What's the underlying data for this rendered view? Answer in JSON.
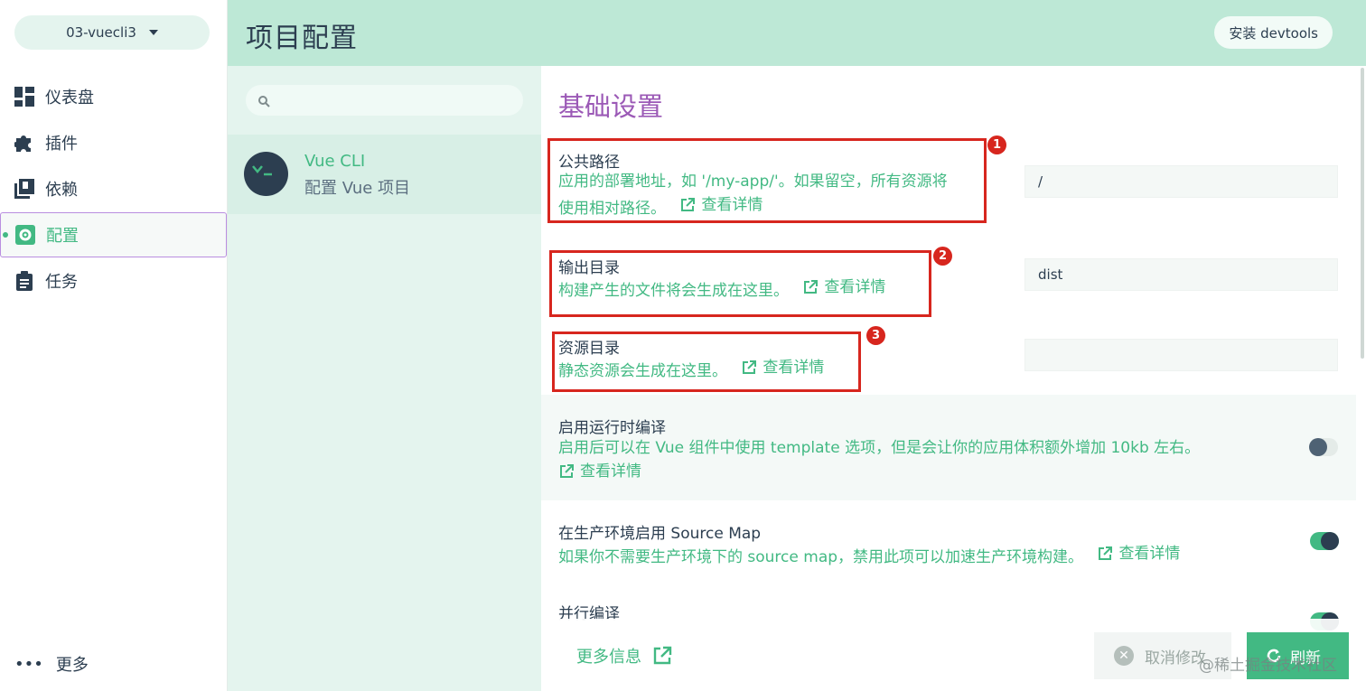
{
  "nav": {
    "project_name": "03-vuecli3",
    "items": [
      {
        "label": "仪表盘",
        "icon": "dashboard-icon"
      },
      {
        "label": "插件",
        "icon": "puzzle-icon"
      },
      {
        "label": "依赖",
        "icon": "library-icon"
      },
      {
        "label": "配置",
        "icon": "gear-icon"
      },
      {
        "label": "任务",
        "icon": "clipboard-icon"
      }
    ],
    "active_item": "配置",
    "more_label": "更多"
  },
  "header": {
    "title": "项目配置",
    "devtools_button": "安装 devtools"
  },
  "sidebar": {
    "search_placeholder": "",
    "configs": [
      {
        "title": "Vue CLI",
        "subtitle": "配置 Vue 项目"
      }
    ]
  },
  "main": {
    "section_title": "基础设置",
    "link_label": "查看详情",
    "prompts": [
      {
        "title": "公共路径",
        "desc_line1": "应用的部署地址，如 '/my-app/'。如果留空，所有资源将",
        "desc_line2": "使用相对路径。",
        "value": "/",
        "badge": "1"
      },
      {
        "title": "输出目录",
        "desc": "构建产生的文件将会生成在这里。",
        "value": "dist",
        "badge": "2"
      },
      {
        "title": "资源目录",
        "desc": "静态资源会生成在这里。",
        "value": "",
        "badge": "3"
      },
      {
        "title": "启用运行时编译",
        "desc": "启用后可以在 Vue 组件中使用 template 选项，但是会让你的应用体积额外增加 10kb 左右。",
        "toggle": false
      },
      {
        "title": "在生产环境启用 Source Map",
        "desc": "如果你不需要生产环境下的 source map，禁用此项可以加速生产环境构建。",
        "toggle": true
      },
      {
        "title": "并行编译",
        "toggle": true
      }
    ]
  },
  "footer": {
    "more_info": "更多信息",
    "cancel": "取消修改",
    "refresh": "刷新",
    "watermark": "@稀土掘金技术社区"
  },
  "colors": {
    "accent": "#42b983",
    "header_bg": "#bde8d6",
    "section_title": "#9b59b6",
    "annotation": "#d7261e",
    "dark": "#2c3e50"
  }
}
